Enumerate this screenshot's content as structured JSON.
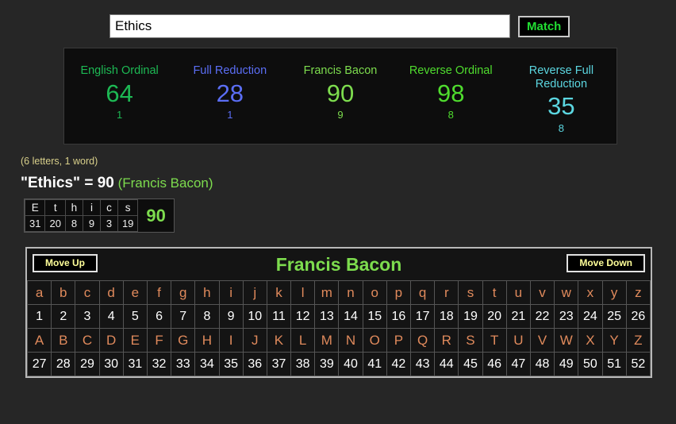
{
  "search": {
    "value": "Ethics",
    "placeholder": "",
    "match_label": "Match"
  },
  "cipher_panel": {
    "ciphers": [
      {
        "name": "English Ordinal",
        "value": "64",
        "sub": "1",
        "color": "#1db954"
      },
      {
        "name": "Full Reduction",
        "value": "28",
        "sub": "1",
        "color": "#5b6ef5"
      },
      {
        "name": "Francis Bacon",
        "value": "90",
        "sub": "9",
        "color": "#7ddc4e"
      },
      {
        "name": "Reverse Ordinal",
        "value": "98",
        "sub": "8",
        "color": "#4fdc2e"
      },
      {
        "name": "Reverse Full Reduction",
        "value": "35",
        "sub": "8",
        "color": "#5bd6e0"
      }
    ]
  },
  "meta": {
    "counts": "(6 letters, 1 word)"
  },
  "result": {
    "phrase": "\"Ethics\" = ",
    "value": "90",
    "cipher_label": " (Francis Bacon)",
    "cipher_color": "#7ddc4e"
  },
  "breakdown": {
    "letters": [
      "E",
      "t",
      "h",
      "i",
      "c",
      "s"
    ],
    "values": [
      "31",
      "20",
      "8",
      "9",
      "3",
      "19"
    ],
    "total": "90"
  },
  "alphabet_panel": {
    "title": "Francis Bacon",
    "move_up_label": "Move Up",
    "move_down_label": "Move Down",
    "lowercase": [
      "a",
      "b",
      "c",
      "d",
      "e",
      "f",
      "g",
      "h",
      "i",
      "j",
      "k",
      "l",
      "m",
      "n",
      "o",
      "p",
      "q",
      "r",
      "s",
      "t",
      "u",
      "v",
      "w",
      "x",
      "y",
      "z"
    ],
    "lowercase_values": [
      "1",
      "2",
      "3",
      "4",
      "5",
      "6",
      "7",
      "8",
      "9",
      "10",
      "11",
      "12",
      "13",
      "14",
      "15",
      "16",
      "17",
      "18",
      "19",
      "20",
      "21",
      "22",
      "23",
      "24",
      "25",
      "26"
    ],
    "uppercase": [
      "A",
      "B",
      "C",
      "D",
      "E",
      "F",
      "G",
      "H",
      "I",
      "J",
      "K",
      "L",
      "M",
      "N",
      "O",
      "P",
      "Q",
      "R",
      "S",
      "T",
      "U",
      "V",
      "W",
      "X",
      "Y",
      "Z"
    ],
    "uppercase_values": [
      "27",
      "28",
      "29",
      "30",
      "31",
      "32",
      "33",
      "34",
      "35",
      "36",
      "37",
      "38",
      "39",
      "40",
      "41",
      "42",
      "43",
      "44",
      "45",
      "46",
      "47",
      "48",
      "49",
      "50",
      "51",
      "52"
    ]
  },
  "colors": {
    "page_bg": "#262626",
    "panel_bg": "#0d0d0d",
    "letter_color": "#e08a5c",
    "number_color": "#ffffff",
    "meta_color": "#d8cf8a"
  }
}
